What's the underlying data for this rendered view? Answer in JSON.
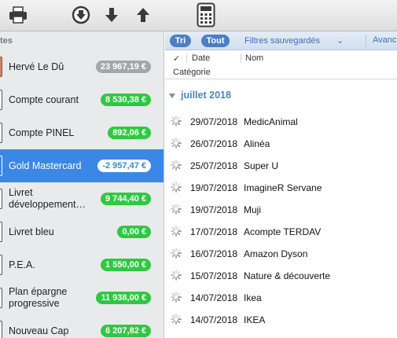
{
  "toolbar": {
    "buttons": [
      {
        "name": "print-icon"
      },
      {
        "name": "download-circle-icon"
      },
      {
        "name": "arrow-down-icon"
      },
      {
        "name": "arrow-up-icon"
      },
      {
        "name": "calculator-icon"
      }
    ]
  },
  "sidebar": {
    "section_label": "tes",
    "accounts": [
      {
        "line1": "Hervé Le Dû",
        "line2": "",
        "amount": "23 967,19 €",
        "style": "gray",
        "selected": false
      },
      {
        "line1": "Compte courant",
        "line2": "",
        "amount": "8 530,38 €",
        "style": "green",
        "selected": false
      },
      {
        "line1": "Compte PINEL",
        "line2": "",
        "amount": "892,06 €",
        "style": "green",
        "selected": false
      },
      {
        "line1": "Gold Mastercard",
        "line2": "",
        "amount": "-2 957,47 €",
        "style": "white",
        "selected": true
      },
      {
        "line1": "Livret",
        "line2": "développement…",
        "amount": "9 744,40 €",
        "style": "green",
        "selected": false
      },
      {
        "line1": "Livret bleu",
        "line2": "",
        "amount": "0,00 €",
        "style": "green",
        "selected": false
      },
      {
        "line1": "P.E.A.",
        "line2": "",
        "amount": "1 550,00 €",
        "style": "green",
        "selected": false
      },
      {
        "line1": "Plan épargne",
        "line2": "progressive",
        "amount": "11 938,00 €",
        "style": "green",
        "selected": false
      },
      {
        "line1": "Nouveau Cap",
        "line2": "",
        "amount": "6 207,82 €",
        "style": "green",
        "selected": false
      }
    ]
  },
  "filters": {
    "tri": "Tri",
    "tout": "Tout",
    "saved": "Filtres sauvegardés",
    "advanced": "Avanc"
  },
  "columns": {
    "check": "✓",
    "date": "Date",
    "nom": "Nom",
    "categorie": "Catégorie"
  },
  "group": {
    "title": "juillet 2018"
  },
  "transactions": [
    {
      "date": "29/07/2018",
      "label": "MedicAnimal"
    },
    {
      "date": "26/07/2018",
      "label": "Alinéa"
    },
    {
      "date": "25/07/2018",
      "label": "Super U"
    },
    {
      "date": "19/07/2018",
      "label": "ImagineR Servane"
    },
    {
      "date": "19/07/2018",
      "label": "Muji"
    },
    {
      "date": "17/07/2018",
      "label": "Acompte TERDAV"
    },
    {
      "date": "16/07/2018",
      "label": "Amazon Dyson"
    },
    {
      "date": "15/07/2018",
      "label": "Nature & découverte"
    },
    {
      "date": "14/07/2018",
      "label": "Ikea"
    },
    {
      "date": "14/07/2018",
      "label": "IKEA"
    }
  ]
}
